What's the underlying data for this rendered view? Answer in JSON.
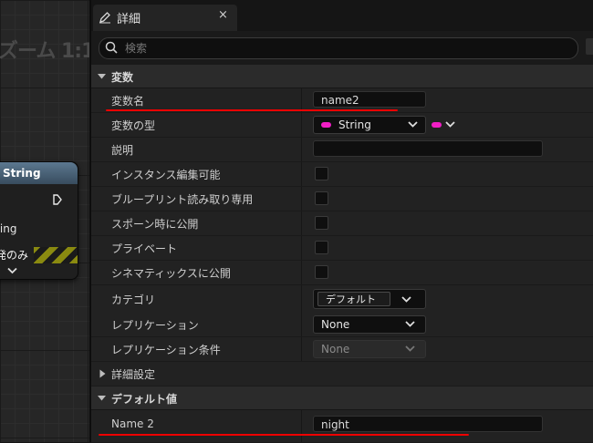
{
  "graph": {
    "zoom_label": "ズーム 1:1",
    "node": {
      "title": "String",
      "output_label": "ring",
      "dev_label": "発のみ"
    }
  },
  "details": {
    "tab_title": "詳細",
    "tab_close": "×",
    "search_placeholder": "検索",
    "sections": {
      "variable": "変数",
      "advanced": "詳細設定",
      "default_value": "デフォルト値"
    },
    "rows": {
      "variable_name": {
        "label": "変数名",
        "value": "name2"
      },
      "variable_type": {
        "label": "変数の型",
        "value": "String"
      },
      "description": {
        "label": "説明",
        "value": ""
      },
      "instance_editable": {
        "label": "インスタンス編集可能"
      },
      "blueprint_read_only": {
        "label": "ブループリント読み取り専用"
      },
      "expose_on_spawn": {
        "label": "スポーン時に公開"
      },
      "private": {
        "label": "プライベート"
      },
      "expose_to_cinematics": {
        "label": "シネマティックスに公開"
      },
      "category": {
        "label": "カテゴリ",
        "value": "デフォルト"
      },
      "replication": {
        "label": "レプリケーション",
        "value": "None"
      },
      "replication_condition": {
        "label": "レプリケーション条件",
        "value": "None"
      },
      "default_name": {
        "label": "Name 2",
        "value": "night"
      }
    },
    "colors": {
      "string_pin": "#f21ec6",
      "annotation": "#ee0000"
    }
  }
}
